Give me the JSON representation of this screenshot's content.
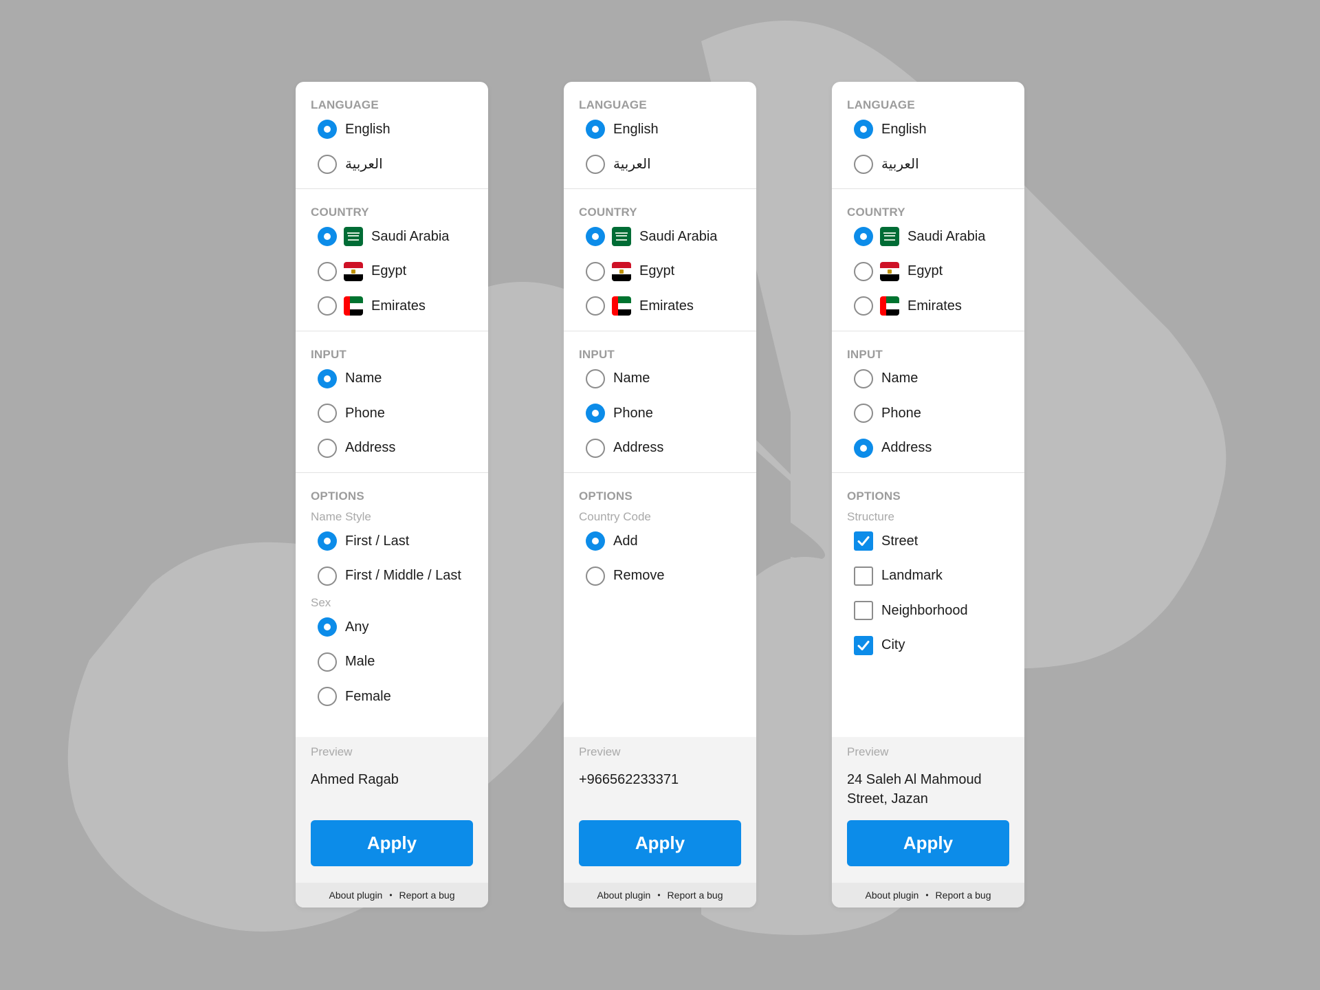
{
  "sections": {
    "language": "LANGUAGE",
    "country": "COUNTRY",
    "input": "INPUT",
    "options": "OPTIONS"
  },
  "languages": [
    "English",
    "العربية"
  ],
  "countries": [
    {
      "name": "Saudi Arabia",
      "flag": "saudi-flag-icon"
    },
    {
      "name": "Egypt",
      "flag": "egypt-flag-icon"
    },
    {
      "name": "Emirates",
      "flag": "uae-flag-icon"
    }
  ],
  "inputs": [
    "Name",
    "Phone",
    "Address"
  ],
  "preview_label": "Preview",
  "apply_label": "Apply",
  "footer": {
    "about": "About plugin",
    "separator": "•",
    "bug": "Report a bug"
  },
  "colors": {
    "accent": "#0c8ce9",
    "background": "#ababab"
  },
  "panels": [
    {
      "language_selected": "English",
      "country_selected": "Saudi Arabia",
      "input_selected": "Name",
      "option_groups": [
        {
          "title": "Name Style",
          "control": "radio",
          "items": [
            {
              "label": "First / Last",
              "checked": true
            },
            {
              "label": "First / Middle / Last",
              "checked": false
            }
          ]
        },
        {
          "title": "Sex",
          "control": "radio",
          "items": [
            {
              "label": "Any",
              "checked": true
            },
            {
              "label": "Male",
              "checked": false
            },
            {
              "label": "Female",
              "checked": false
            }
          ]
        }
      ],
      "preview_value": "Ahmed Ragab"
    },
    {
      "language_selected": "English",
      "country_selected": "Saudi Arabia",
      "input_selected": "Phone",
      "option_groups": [
        {
          "title": "Country Code",
          "control": "radio",
          "items": [
            {
              "label": "Add",
              "checked": true
            },
            {
              "label": "Remove",
              "checked": false
            }
          ]
        }
      ],
      "preview_value": "+966562233371"
    },
    {
      "language_selected": "English",
      "country_selected": "Saudi Arabia",
      "input_selected": "Address",
      "option_groups": [
        {
          "title": "Structure",
          "control": "checkbox",
          "items": [
            {
              "label": "Street",
              "checked": true
            },
            {
              "label": "Landmark",
              "checked": false
            },
            {
              "label": "Neighborhood",
              "checked": false
            },
            {
              "label": "City",
              "checked": true
            }
          ]
        }
      ],
      "preview_value": "24 Saleh Al Mahmoud Street, Jazan"
    }
  ]
}
